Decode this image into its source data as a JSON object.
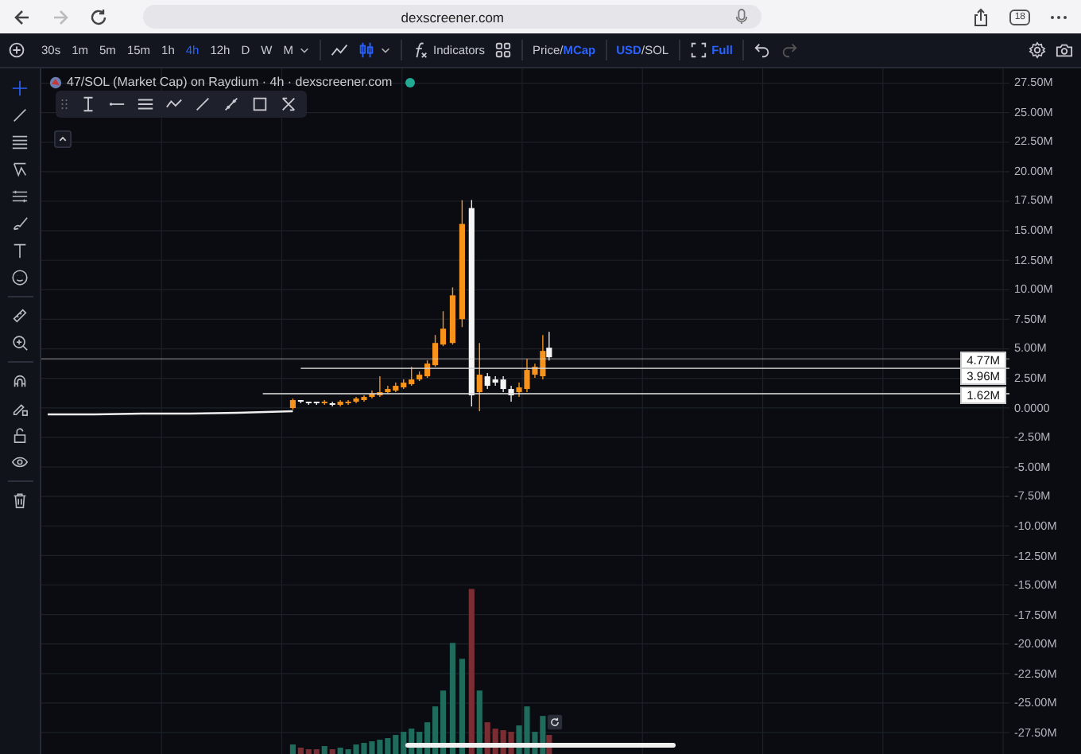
{
  "browser": {
    "back_disabled": false,
    "forward_disabled": true,
    "url": "dexscreener.com",
    "tab_count": "18"
  },
  "toolbar": {
    "timeframes": [
      {
        "label": "30s",
        "selected": false
      },
      {
        "label": "1m",
        "selected": false
      },
      {
        "label": "5m",
        "selected": false
      },
      {
        "label": "15m",
        "selected": false
      },
      {
        "label": "1h",
        "selected": false
      },
      {
        "label": "4h",
        "selected": true
      },
      {
        "label": "12h",
        "selected": false
      },
      {
        "label": "D",
        "selected": false
      },
      {
        "label": "W",
        "selected": false
      },
      {
        "label": "M",
        "selected": false
      }
    ],
    "indicators": "Indicators",
    "price_toggle": {
      "separator": "/",
      "options": [
        {
          "label": "Price",
          "selected": false
        },
        {
          "label": "MCap",
          "selected": true
        }
      ]
    },
    "currency_toggle": {
      "separator": "/",
      "options": [
        {
          "label": "USD",
          "selected": true
        },
        {
          "label": "SOL",
          "selected": false
        }
      ]
    },
    "full": {
      "label": "Full",
      "selected": true
    },
    "redo_disabled": true
  },
  "left_tools": [
    {
      "kind": "crosshair",
      "selected": true
    },
    {
      "kind": "trendline",
      "selected": false
    },
    {
      "kind": "fib",
      "selected": false
    },
    {
      "kind": "pattern",
      "selected": false
    },
    {
      "kind": "projection",
      "selected": false
    },
    {
      "kind": "brush",
      "selected": false
    },
    {
      "kind": "text",
      "selected": false
    },
    {
      "kind": "emoji",
      "selected": false
    },
    {
      "kind": "ruler",
      "selected": false
    },
    {
      "kind": "zoom",
      "selected": false
    },
    {
      "kind": "magnet",
      "selected": false
    },
    {
      "kind": "lock-draw",
      "selected": false
    },
    {
      "kind": "lock",
      "selected": false
    },
    {
      "kind": "eye",
      "selected": false
    },
    {
      "kind": "trash",
      "selected": false
    }
  ],
  "chart": {
    "title": "47/SOL (Market Cap) on Raydium · 4h · dexscreener.com",
    "live": true,
    "y_axis_labels": [
      "27.50M",
      "25.00M",
      "22.50M",
      "20.00M",
      "17.50M",
      "15.00M",
      "12.50M",
      "10.00M",
      "7.50M",
      "5.00M",
      "2.50M",
      "0.0000",
      "-2.50M",
      "-5.00M",
      "-7.50M",
      "-10.00M",
      "-12.50M",
      "-15.00M",
      "-17.50M",
      "-20.00M",
      "-22.50M",
      "-25.00M",
      "-27.50M"
    ],
    "price_tags": [
      "4.77M",
      "3.96M",
      "1.62M"
    ]
  }
}
